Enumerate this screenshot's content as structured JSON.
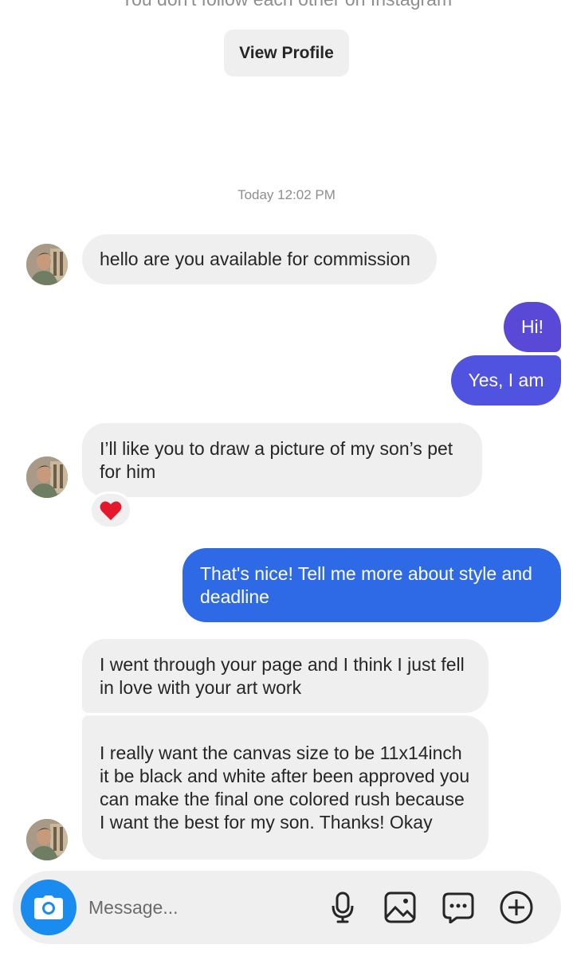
{
  "header": {
    "follow_note": "You don't follow each other on Instagram",
    "view_profile_label": "View Profile"
  },
  "thread": {
    "timestamp": "Today 12:02 PM",
    "messages": [
      {
        "from": "them",
        "text": "hello are you available for commission"
      },
      {
        "from": "me",
        "text": "Hi!"
      },
      {
        "from": "me",
        "text": "Yes, I am"
      },
      {
        "from": "them",
        "text": "I’ll like you to draw a picture of my son’s pet for him",
        "reaction": "heart"
      },
      {
        "from": "me",
        "text": "That's nice! Tell me more about style and deadline"
      },
      {
        "from": "them",
        "text": "I went through your page and I think I just fell in love with your art work"
      },
      {
        "from": "them",
        "text": "I really want the canvas size to be 11x14inch it be black and white after been approved you can make the final one colored rush because I want the best for my son. Thanks! Okay"
      }
    ]
  },
  "composer": {
    "placeholder": "Message...",
    "icons": [
      "camera-icon",
      "microphone-icon",
      "gallery-icon",
      "sticker-icon",
      "plus-icon"
    ]
  },
  "colors": {
    "outgoing_purple": "#5a48d6",
    "outgoing_blue": "#2f6ae6",
    "incoming_bg": "#efefef",
    "camera_blue": "#1a8cf0",
    "reaction_red": "#e3192b"
  }
}
